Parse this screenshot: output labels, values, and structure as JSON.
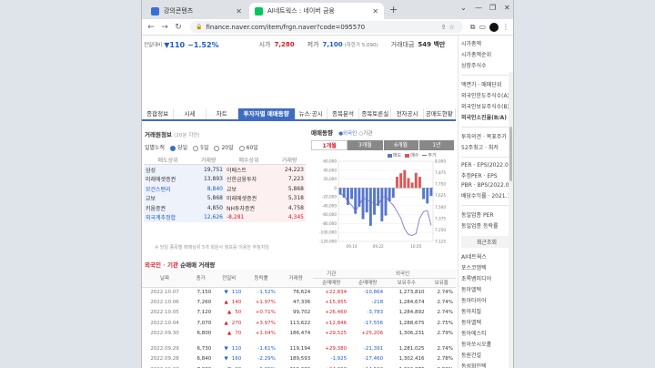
{
  "browser": {
    "tab1_title": "강의콘텐츠",
    "tab2_title": "AI네트웍스 : 네이버 금융",
    "url": "finance.naver.com/item/frgn.naver?code=095570",
    "colors": {
      "tab1_icon": "#3b6fd8",
      "tab2_icon": "#03c75a"
    }
  },
  "stock_header": {
    "change_label": "전일대비",
    "change_value": "▼110",
    "change_pct": "−1.52%",
    "open_label": "시가",
    "open_value": "7,280",
    "low_label": "저가",
    "low_value": "7,100",
    "low_note": "(하한가 5,090)",
    "amount_label": "거래대금",
    "amount_value": "549 백만"
  },
  "tabs": [
    {
      "label": "종합정보"
    },
    {
      "label": "시세"
    },
    {
      "label": "차트"
    },
    {
      "label": "투자자별 매매동향"
    },
    {
      "label": "뉴스·공시"
    },
    {
      "label": "종목분석"
    },
    {
      "label": "종목토론실"
    },
    {
      "label": "전자공시"
    },
    {
      "label": "공매도현황"
    }
  ],
  "broker": {
    "title": "거래원정보",
    "subtitle": "(20분 지연)",
    "period_label": "일별누적",
    "periods": [
      "당일",
      "5일",
      "20일",
      "60일"
    ],
    "headers": [
      "매도상위",
      "거래량",
      "매수상위",
      "거래량"
    ],
    "rows": [
      {
        "seller": "삼성",
        "sell_vol": "19,751",
        "buyer": "이베스트",
        "buy_vol": "24,223"
      },
      {
        "seller": "미래에셋증권",
        "sell_vol": "13,893",
        "buyer": "신한금융투자",
        "buy_vol": "7,223"
      },
      {
        "seller": "모건스탠리",
        "sell_vol": "8,840",
        "buyer": "교보",
        "buy_vol": "5,868"
      },
      {
        "seller": "교보",
        "sell_vol": "5,868",
        "buyer": "미래에셋증권",
        "buy_vol": "5,318"
      },
      {
        "seller": "키움증권",
        "sell_vol": "4,850",
        "buyer": "NH투자증권",
        "buy_vol": "4,758"
      }
    ],
    "foreign_label": "외국계추정합",
    "foreign_sell": "12,626",
    "foreign_net": "-8,281",
    "foreign_buy": "4,345",
    "note": "※ 당일 종목별 매매상위 5개 회원사 정보를 이용한 추정치임"
  },
  "trend": {
    "title": "매매동향",
    "selected": "외국인",
    "org_label": "기관",
    "period_tabs": [
      "1개월",
      "3개월",
      "6개월",
      "1년"
    ],
    "legend": [
      "매도",
      "매수",
      "주가"
    ],
    "colors": {
      "sell": "#5577cc",
      "buy": "#e05555",
      "price": "#7766cc"
    }
  },
  "chart_data": {
    "type": "bar",
    "x_ticks": [
      "09.14",
      "09.22",
      "10.05"
    ],
    "y_left_ticks": [
      "60,000",
      "40,000",
      "20,000",
      "0",
      "-20,000",
      "-40,000",
      "-60,000",
      "-80,000",
      "-100,000",
      "-120,000"
    ],
    "y_right_ticks": [
      "8,000",
      "7,875",
      "7,750",
      "7,625",
      "7,500",
      "7,375",
      "7,250",
      "7,125"
    ],
    "ylim_left": [
      -120000,
      60000
    ],
    "ylim_right": [
      7125,
      8000
    ],
    "values": [
      -15000,
      -22000,
      -38000,
      -25000,
      -58000,
      -42000,
      -70000,
      -55000,
      -85000,
      -60000,
      -40000,
      -75000,
      -62000,
      -30000,
      -22000,
      25000,
      33000,
      40000,
      22000,
      12000,
      34000,
      25000,
      -25000,
      -35000,
      -18000
    ],
    "price": [
      7650,
      7620,
      7560,
      7520,
      7460,
      7520,
      7600,
      7580,
      7560,
      7540,
      7520,
      7600,
      7620,
      7560,
      7520,
      7450,
      7380,
      7260,
      7200,
      7190,
      7210,
      7380,
      7450,
      7460,
      7300
    ]
  },
  "trade_table": {
    "section_label_foreign": "외국인",
    "section_label_org": "기관",
    "section_label_rest": "순매매 거래량",
    "group_org": "기관",
    "group_foreign": "외국인",
    "headers": [
      "날짜",
      "종가",
      "전일비",
      "등락률",
      "거래량",
      "순매매량",
      "순매매량",
      "보유주수",
      "보유율"
    ],
    "rows": [
      {
        "date": "2022.10.07",
        "close": "7,150",
        "dir": "▼",
        "diff": "110",
        "rate": "-1.52%",
        "vol": "76,624",
        "org": "+22,834",
        "frgn": "-10,864",
        "hold": "1,273,810",
        "ratio": "2.74%"
      },
      {
        "date": "2022.10.06",
        "close": "7,260",
        "dir": "▲",
        "diff": "140",
        "rate": "+1.97%",
        "vol": "47,336",
        "org": "+15,955",
        "frgn": "-218",
        "hold": "1,284,674",
        "ratio": "2.74%"
      },
      {
        "date": "2022.10.05",
        "close": "7,120",
        "dir": "▲",
        "diff": "50",
        "rate": "+0.71%",
        "vol": "99,702",
        "org": "+26,460",
        "frgn": "-3,783",
        "hold": "1,284,892",
        "ratio": "2.74%"
      },
      {
        "date": "2022.10.04",
        "close": "7,070",
        "dir": "▲",
        "diff": "270",
        "rate": "+3.97%",
        "vol": "113,622",
        "org": "+12,846",
        "frgn": "-17,556",
        "hold": "1,288,675",
        "ratio": "2.75%"
      },
      {
        "date": "2022.09.30",
        "close": "6,800",
        "dir": "▲",
        "diff": "70",
        "rate": "+1.04%",
        "vol": "186,474",
        "org": "+29,525",
        "frgn": "+25,206",
        "hold": "1,306,231",
        "ratio": "2.79%"
      },
      {
        "date": "2022.09.29",
        "close": "6,730",
        "dir": "▼",
        "diff": "110",
        "rate": "-1.61%",
        "vol": "119,194",
        "org": "+29,380",
        "frgn": "-21,391",
        "hold": "1,281,025",
        "ratio": "2.74%"
      },
      {
        "date": "2022.09.28",
        "close": "6,840",
        "dir": "▼",
        "diff": "160",
        "rate": "-2.29%",
        "vol": "189,593",
        "org": "-1,925",
        "frgn": "-17,460",
        "hold": "1,302,416",
        "ratio": "2.78%"
      },
      {
        "date": "2022.09.27",
        "close": "7,000",
        "dir": "▼",
        "diff": "60",
        "rate": "-0.85%",
        "vol": "219,636",
        "org": "+24,808",
        "frgn": "+14,523",
        "hold": "1,319,876",
        "ratio": "2.82%"
      },
      {
        "date": "2022.09.26",
        "close": "7,060",
        "dir": "▼",
        "diff": "500",
        "rate": "-6.61%",
        "vol": "230,709",
        "org": "+22,964",
        "frgn": "+19,253",
        "hold": "1,305,353",
        "ratio": "2.79%"
      }
    ]
  },
  "sidebar": {
    "items": [
      "시가총액",
      "시가총액순위",
      "상장주식수",
      "액면가 · 매매단위",
      "외국인한도주식수(A)",
      "외국인보유주식수(B)",
      "외국인소진율(B/A)",
      "투자의견 · 목표주가",
      "52주최고 · 최저",
      "PER · EPS(2022.06)",
      "추정PER · EPS",
      "PBR · BPS(2022.06)",
      "배당수익률 · 2021.12",
      "동일업종 PER",
      "동일업종 등락률"
    ],
    "box_title": "최근조회",
    "recent": [
      "AI네트웍스",
      "포스코엠텍",
      "초록뱀미디어",
      "동아엘텍",
      "동아타이어",
      "동아지질",
      "동아엘텍",
      "동아에스티",
      "동아쏘시오홀",
      "동원건설",
      "동성화인텍"
    ]
  }
}
